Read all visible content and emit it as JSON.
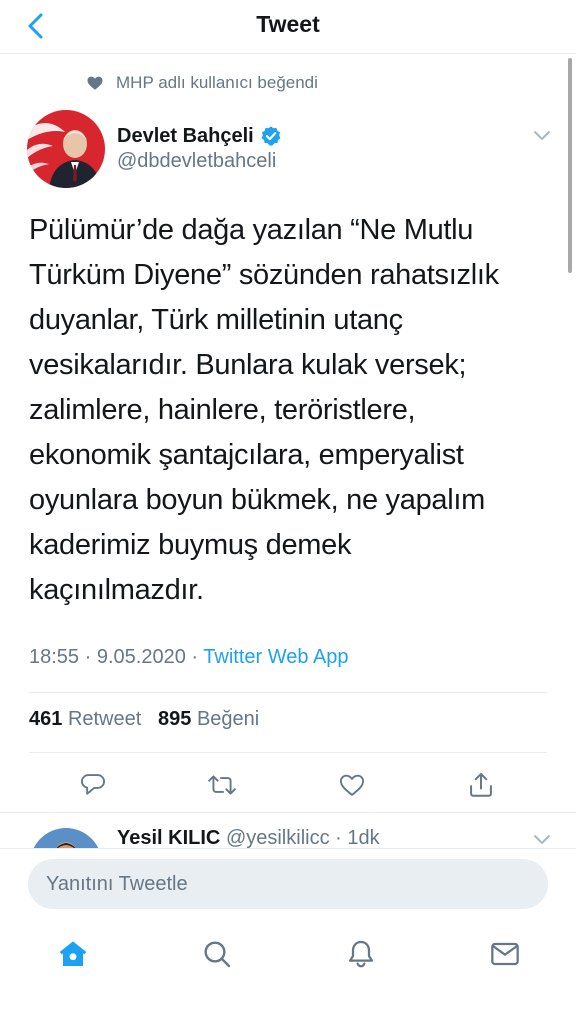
{
  "header": {
    "title": "Tweet"
  },
  "social_context": {
    "text": "MHP adlı kullanıcı beğendi"
  },
  "author": {
    "name": "Devlet Bahçeli",
    "handle": "@dbdevletbahceli",
    "verified": true
  },
  "tweet": {
    "text": "Pülümür’de dağa yazılan “Ne Mutlu\nTürküm Diyene” sözünden rahatsızlık\nduyanlar, Türk milletinin utanç\nvesikalarıdır. Bunlara kulak versek;\nzalimlere, hainlere, teröristlere,\nekonomik şantajcılara, emperyalist\noyunlara boyun bükmek, ne yapalım\nkaderimiz buymuş demek\nkaçınılmazdır.",
    "time": "18:55",
    "date": "9.05.2020",
    "separator": "·",
    "source": "Twitter Web App"
  },
  "stats": {
    "retweets_count": "461",
    "retweets_label": "Retweet",
    "likes_count": "895",
    "likes_label": "Beğeni"
  },
  "reply_preview": {
    "name": "Yesil KILIC",
    "handle": "@yesilkilicc",
    "separator": "·",
    "time": "1dk"
  },
  "composer": {
    "placeholder": "Yanıtını Tweetle"
  },
  "colors": {
    "accent": "#1da1f2",
    "muted": "#657786",
    "text": "#14171a"
  },
  "icons": [
    "back-chevron-icon",
    "heart-icon",
    "verified-icon",
    "chevron-down-icon",
    "reply-icon",
    "retweet-icon",
    "like-icon",
    "share-icon",
    "home-icon",
    "search-icon",
    "notifications-icon",
    "messages-icon"
  ]
}
